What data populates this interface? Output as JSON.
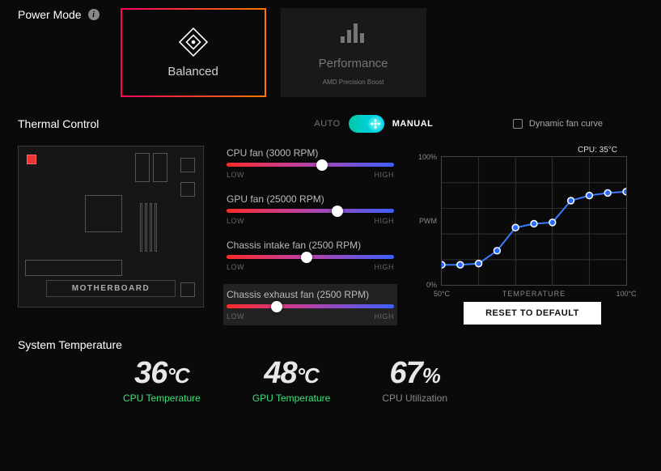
{
  "power": {
    "title": "Power Mode",
    "modes": [
      {
        "label": "Balanced",
        "selected": true
      },
      {
        "label": "Performance",
        "selected": false,
        "sub": "AMD Precision Boost"
      }
    ]
  },
  "thermal": {
    "title": "Thermal Control",
    "auto_label": "AUTO",
    "manual_label": "MANUAL",
    "mode": "manual",
    "dynamic_curve_label": "Dynamic fan curve",
    "dynamic_curve_checked": false,
    "mobo_label": "MOTHERBOARD",
    "low": "LOW",
    "high": "HIGH",
    "fans": [
      {
        "name": "CPU fan",
        "rpm": 3000,
        "percent": 57
      },
      {
        "name": "GPU fan",
        "rpm": 25000,
        "percent": 66
      },
      {
        "name": "Chassis intake fan",
        "rpm": 2500,
        "percent": 48
      },
      {
        "name": "Chassis exhaust fan",
        "rpm": 2500,
        "percent": 30,
        "selected": true
      }
    ],
    "cpu_stat": "CPU: 35°C",
    "reset_label": "RESET TO DEFAULT"
  },
  "chart_data": {
    "type": "line",
    "title": "Fan curve",
    "xlabel": "TEMPERATURE",
    "ylabel": "PWM",
    "xlim": [
      50,
      100
    ],
    "ylim": [
      0,
      100
    ],
    "xticks": [
      "50°C",
      "100°C"
    ],
    "yticks": [
      "0%",
      "100%"
    ],
    "x": [
      50,
      55,
      60,
      65,
      70,
      75,
      80,
      85,
      90,
      95,
      100
    ],
    "y": [
      16,
      16,
      17,
      27,
      45,
      48,
      49,
      66,
      70,
      72,
      73
    ]
  },
  "systemp": {
    "title": "System Temperature",
    "stats": [
      {
        "value": "36",
        "unit": "°C",
        "label": "CPU Temperature",
        "color": "green"
      },
      {
        "value": "48",
        "unit": "°C",
        "label": "GPU Temperature",
        "color": "green"
      },
      {
        "value": "67",
        "unit": "%",
        "label": "CPU Utilization",
        "color": "gray"
      }
    ]
  }
}
